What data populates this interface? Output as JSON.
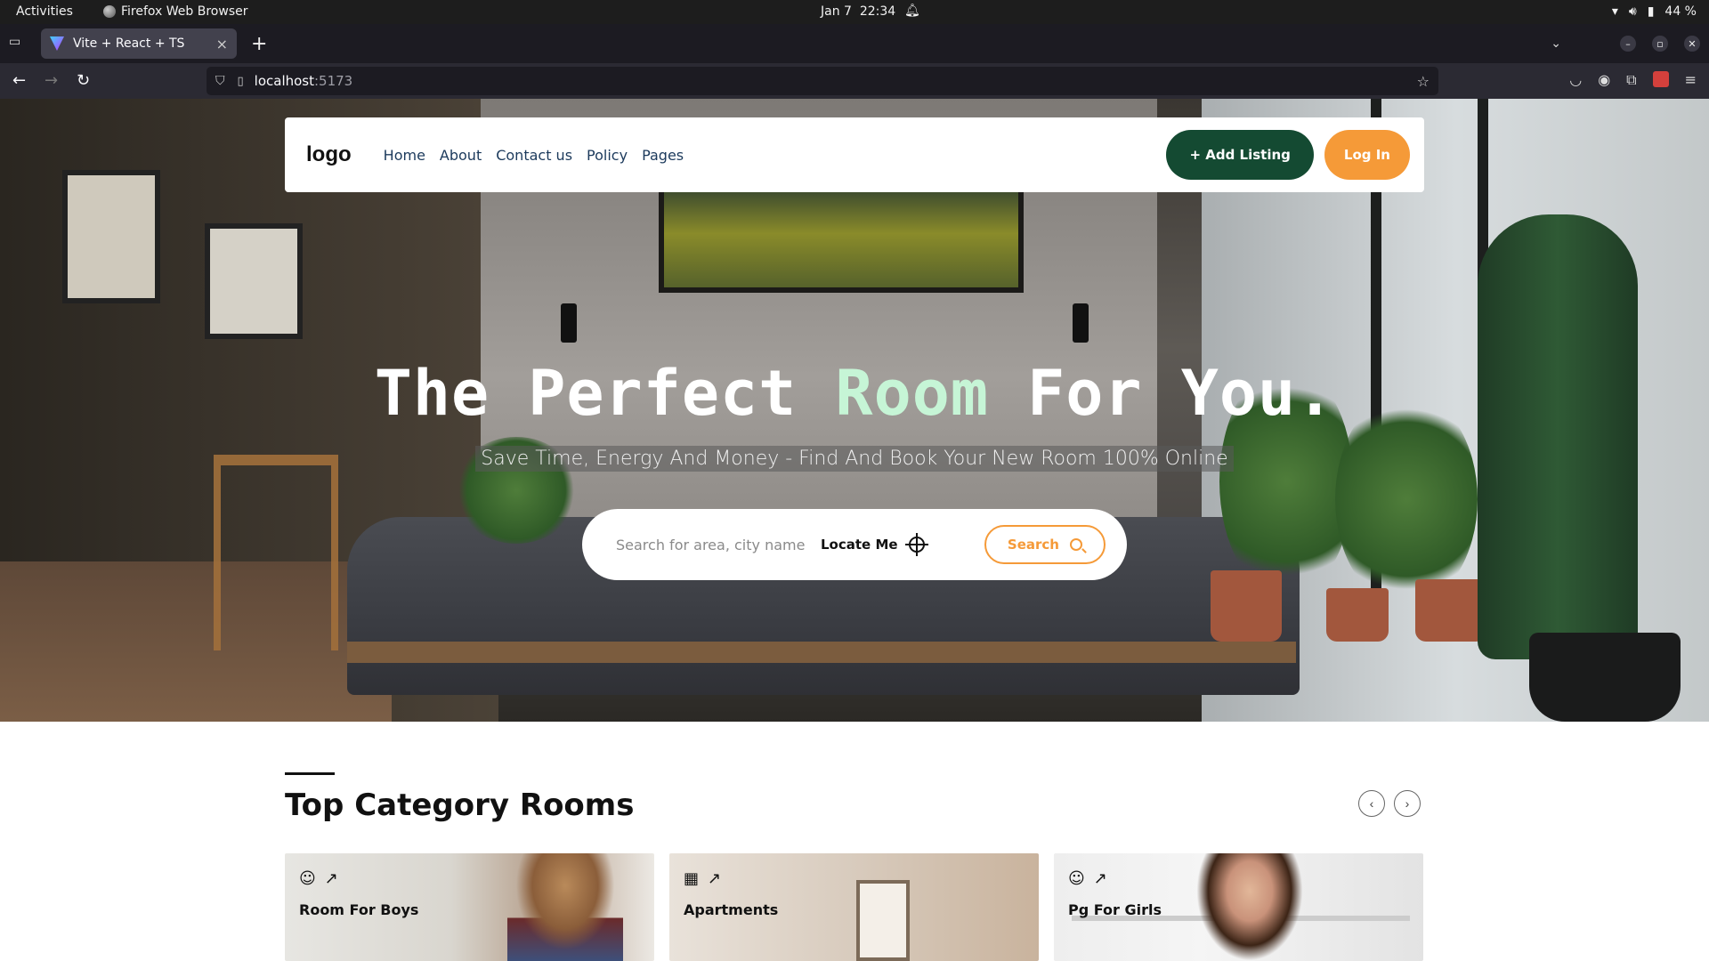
{
  "system_bar": {
    "activities": "Activities",
    "app_name": "Firefox Web Browser",
    "date": "Jan 7",
    "time": "22:34",
    "battery": "44 %"
  },
  "browser": {
    "tab_title": "Vite + React + TS",
    "url_host": "localhost",
    "url_port": ":5173"
  },
  "header": {
    "logo": "logo",
    "nav": [
      "Home",
      "About",
      "Contact us",
      "Policy",
      "Pages"
    ],
    "add_listing": "+ Add Listing",
    "login": "Log In"
  },
  "hero": {
    "title_part1": "The Perfect ",
    "title_accent": "Room",
    "title_part2": " For You.",
    "subtitle": "Save Time, Energy And Money - Find And Book Your New Room 100% Online",
    "accent_color": "#c6f5d6"
  },
  "search": {
    "placeholder": "Search for area, city name",
    "locate_label": "Locate Me",
    "search_label": "Search"
  },
  "section": {
    "title": "Top Category Rooms",
    "cards": [
      {
        "label": "Room For Boys",
        "icon": "face-icon"
      },
      {
        "label": "Apartments",
        "icon": "building-icon"
      },
      {
        "label": "Pg For Girls",
        "icon": "face-icon"
      }
    ]
  },
  "colors": {
    "brand_green": "#144a32",
    "brand_orange": "#f59a38",
    "nav_link": "#1c3a5c"
  }
}
